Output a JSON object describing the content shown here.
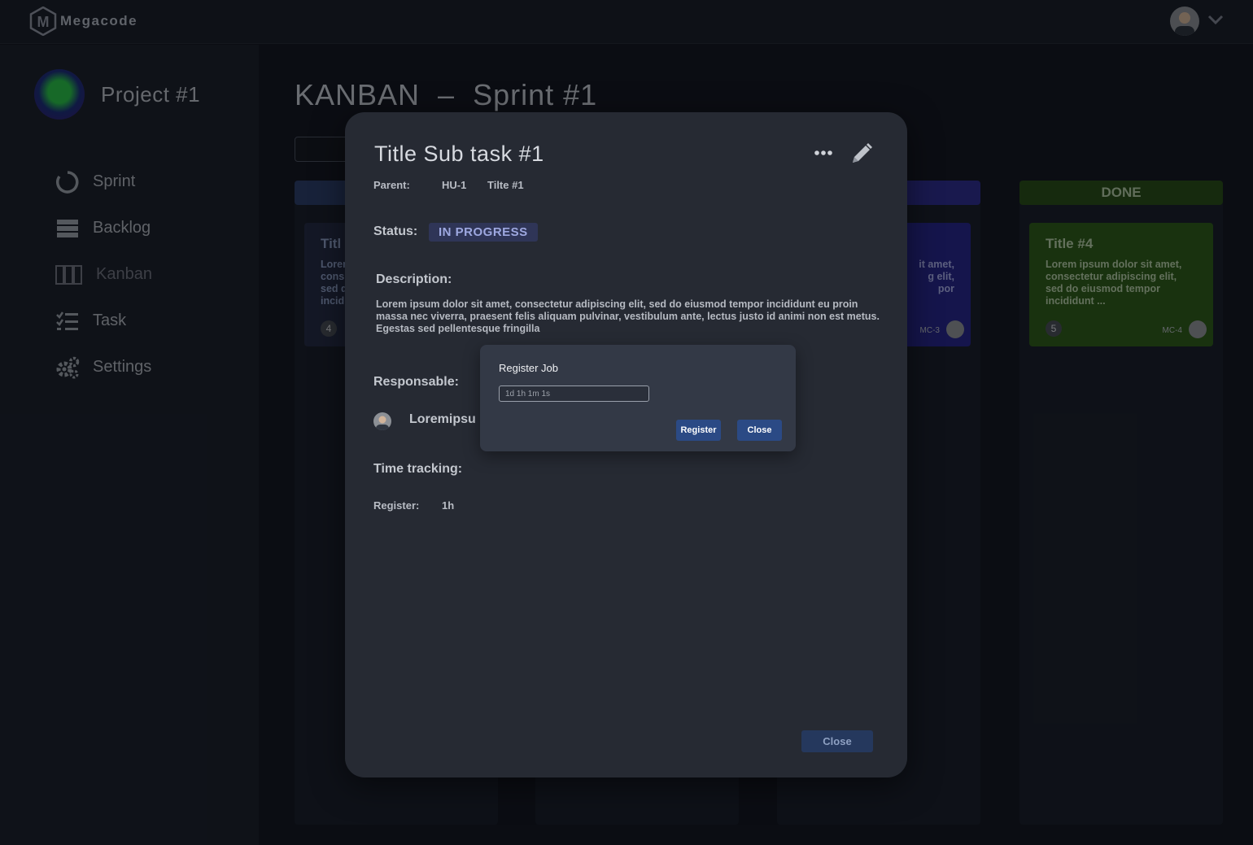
{
  "app": {
    "name": "Megacode",
    "logo_letter": "M"
  },
  "header": {
    "user_avatar_icon": "user-avatar",
    "dropdown_icon": "chevron-down-icon"
  },
  "sidebar": {
    "project_name": "Project #1",
    "items": [
      {
        "label": "Sprint",
        "icon": "sprint-icon"
      },
      {
        "label": "Backlog",
        "icon": "backlog-icon"
      },
      {
        "label": "Kanban",
        "icon": "kanban-icon"
      },
      {
        "label": "Task",
        "icon": "task-icon"
      },
      {
        "label": "Settings",
        "icon": "settings-icon"
      }
    ]
  },
  "board": {
    "title": "KANBAN  –  Sprint #1",
    "columns": [
      {
        "header": "",
        "color": "#2c3e6b",
        "card": {
          "title": "Titl",
          "text": "Lorem\ncons\nsed d\nincid",
          "num": "4",
          "code": "",
          "color": "#262c45"
        }
      },
      {
        "header": "",
        "color": "#2b2d3f",
        "card": null
      },
      {
        "header": "",
        "color": "#2e2f8e",
        "card": {
          "title": "",
          "text": "it amet,\ng elit,\npor",
          "num": "",
          "code": "MC-3",
          "color": "#27278a"
        }
      },
      {
        "header": "DONE",
        "color": "#294d1a",
        "card": {
          "title": "Title #4",
          "text": "Lorem ipsum dolor sit amet, consectetur adipiscing elit, sed do eiusmod tempor incididunt ...",
          "num": "5",
          "code": "MC-4",
          "color": "#2f5b1d"
        }
      }
    ]
  },
  "modal": {
    "title": "Title Sub task #1",
    "parent_label": "Parent:",
    "parent_code": "HU-1",
    "parent_title": "Tilte #1",
    "status_label": "Status:",
    "status_value": "IN PROGRESS",
    "description_label": "Description:",
    "description": "Lorem ipsum dolor sit amet, consectetur adipiscing elit, sed do eiusmod tempor incididunt eu proin massa nec viverra, praesent felis aliquam pulvinar, vestibulum ante, lectus justo id animi non est metus. Egestas sed pellentesque fringilla",
    "responsible_label": "Responsable:",
    "responsible_name": "Loremipsu",
    "time_tracking_label": "Time tracking:",
    "register_label": "Register:",
    "register_value": "1h",
    "close_label": "Close",
    "more_icon": "more-horizontal-icon",
    "edit_icon": "pencil-icon"
  },
  "dialog": {
    "title": "Register Job",
    "input_placeholder": "1d 1h 1m 1s",
    "input_value": "",
    "register_button": "Register",
    "close_button": "Close"
  },
  "colors": {
    "accent": "#2b4a85",
    "status_badge": "#2f3557",
    "modal_bg": "#262a33"
  }
}
